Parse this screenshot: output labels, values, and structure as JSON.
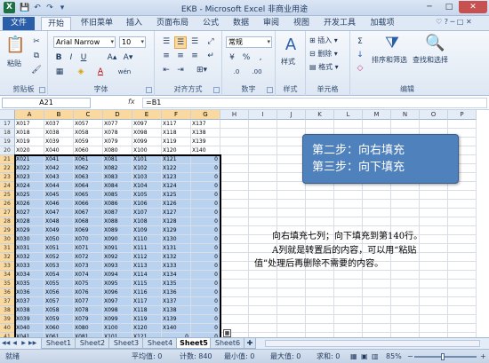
{
  "window": {
    "title": "EKB - Microsoft Excel 非商业用途",
    "app_icon": "X",
    "minimize": "─",
    "maximize": "□",
    "close": "✕"
  },
  "qat": [
    "💾",
    "↶",
    "↷",
    "▾"
  ],
  "tabs": [
    "文件",
    "开始",
    "插入",
    "页面布局",
    "公式",
    "数据",
    "审阅",
    "视图",
    "开发工具",
    "加载项"
  ],
  "tabs_extra": [
    "怀旧菜单"
  ],
  "ribbon_right": "♡ ? ─ □ ✕",
  "ribbon": {
    "clipboard": {
      "label": "剪贴板",
      "paste": "粘贴",
      "cut": "✂",
      "copy": "⧉",
      "painter": "🖌"
    },
    "font": {
      "label": "字体",
      "name": "Arial Narrow",
      "size": "10",
      "bold": "B",
      "italic": "I",
      "underline": "U",
      "grow": "A▴",
      "shrink": "A▾",
      "border": "▦",
      "fill": "◈",
      "color": "A",
      "wen": "wén"
    },
    "align": {
      "label": "对齐方式"
    },
    "number": {
      "label": "数字",
      "format": "常规",
      "percent": "%",
      "comma": ",",
      "currency": "¥",
      "inc": ".0",
      "dec": ".00"
    },
    "styles": {
      "label": "样式",
      "btn": "样式"
    },
    "cells": {
      "label": "单元格",
      "insert": "插入",
      "delete": "删除",
      "format": "格式"
    },
    "editing": {
      "label": "编辑",
      "sigma": "Σ",
      "fill": "↓",
      "clear": "◇",
      "sort": "排序和筛选",
      "find": "查找和选择"
    }
  },
  "formula_bar": {
    "name_box": "A21",
    "fx": "fx",
    "formula": "=B1"
  },
  "columns": [
    "A",
    "B",
    "C",
    "D",
    "E",
    "F",
    "G",
    "H",
    "I",
    "J",
    "K",
    "L",
    "M",
    "N",
    "O",
    "P"
  ],
  "selected_columns": [
    "A",
    "B",
    "C",
    "D",
    "E",
    "F",
    "G"
  ],
  "rows": [
    {
      "n": "17",
      "cells": [
        "X017",
        "X037",
        "X057",
        "X077",
        "X097",
        "X117",
        "X137"
      ]
    },
    {
      "n": "18",
      "cells": [
        "X018",
        "X038",
        "X058",
        "X078",
        "X098",
        "X118",
        "X138"
      ]
    },
    {
      "n": "19",
      "cells": [
        "X019",
        "X039",
        "X059",
        "X079",
        "X099",
        "X119",
        "X139"
      ]
    },
    {
      "n": "20",
      "cells": [
        "X020",
        "X040",
        "X060",
        "X080",
        "X100",
        "X120",
        "X140"
      ]
    },
    {
      "n": "21",
      "cells": [
        "X021",
        "X041",
        "X061",
        "X081",
        "X101",
        "X121",
        "0"
      ]
    },
    {
      "n": "22",
      "cells": [
        "X022",
        "X042",
        "X062",
        "X082",
        "X102",
        "X122",
        "0"
      ]
    },
    {
      "n": "23",
      "cells": [
        "X023",
        "X043",
        "X063",
        "X083",
        "X103",
        "X123",
        "0"
      ]
    },
    {
      "n": "24",
      "cells": [
        "X024",
        "X044",
        "X064",
        "X084",
        "X104",
        "X124",
        "0"
      ]
    },
    {
      "n": "25",
      "cells": [
        "X025",
        "X045",
        "X065",
        "X085",
        "X105",
        "X125",
        "0"
      ]
    },
    {
      "n": "26",
      "cells": [
        "X026",
        "X046",
        "X066",
        "X086",
        "X106",
        "X126",
        "0"
      ]
    },
    {
      "n": "27",
      "cells": [
        "X027",
        "X047",
        "X067",
        "X087",
        "X107",
        "X127",
        "0"
      ]
    },
    {
      "n": "28",
      "cells": [
        "X028",
        "X048",
        "X068",
        "X088",
        "X108",
        "X128",
        "0"
      ]
    },
    {
      "n": "29",
      "cells": [
        "X029",
        "X049",
        "X069",
        "X089",
        "X109",
        "X129",
        "0"
      ]
    },
    {
      "n": "30",
      "cells": [
        "X030",
        "X050",
        "X070",
        "X090",
        "X110",
        "X130",
        "0"
      ]
    },
    {
      "n": "31",
      "cells": [
        "X031",
        "X051",
        "X071",
        "X091",
        "X111",
        "X131",
        "0"
      ]
    },
    {
      "n": "32",
      "cells": [
        "X032",
        "X052",
        "X072",
        "X092",
        "X112",
        "X132",
        "0"
      ]
    },
    {
      "n": "33",
      "cells": [
        "X033",
        "X053",
        "X073",
        "X093",
        "X113",
        "X133",
        "0"
      ]
    },
    {
      "n": "34",
      "cells": [
        "X034",
        "X054",
        "X074",
        "X094",
        "X114",
        "X134",
        "0"
      ]
    },
    {
      "n": "35",
      "cells": [
        "X035",
        "X055",
        "X075",
        "X095",
        "X115",
        "X135",
        "0"
      ]
    },
    {
      "n": "36",
      "cells": [
        "X036",
        "X056",
        "X076",
        "X096",
        "X116",
        "X136",
        "0"
      ]
    },
    {
      "n": "37",
      "cells": [
        "X037",
        "X057",
        "X077",
        "X097",
        "X117",
        "X137",
        "0"
      ]
    },
    {
      "n": "38",
      "cells": [
        "X038",
        "X058",
        "X078",
        "X098",
        "X118",
        "X138",
        "0"
      ]
    },
    {
      "n": "39",
      "cells": [
        "X039",
        "X059",
        "X079",
        "X099",
        "X119",
        "X139",
        "0"
      ]
    },
    {
      "n": "40",
      "cells": [
        "X040",
        "X060",
        "X080",
        "X100",
        "X120",
        "X140",
        "0"
      ]
    },
    {
      "n": "41",
      "cells": [
        "X041",
        "X061",
        "X081",
        "X101",
        "X121",
        "0",
        "0"
      ]
    }
  ],
  "callout": {
    "line1": "第二步：向右填充",
    "line2": "第三步：向下填充"
  },
  "note": {
    "p1": "向右填充七列；向下填充到第140行。",
    "p2": "A列就是转置后的内容，可以用“粘贴值”处理后再删除不需要的内容。"
  },
  "sheets": [
    "Sheet1",
    "Sheet2",
    "Sheet3",
    "Sheet4",
    "Sheet5",
    "Sheet6"
  ],
  "active_sheet": "Sheet5",
  "sheet_nav": [
    "◀◀",
    "◀",
    "▶",
    "▶▶"
  ],
  "status": {
    "mode": "就绪",
    "avg": "平均值: 0",
    "count": "计数: 840",
    "min": "最小值: 0",
    "max": "最大值: 0",
    "sum": "求和: 0",
    "zoom": "85%",
    "zoom_level": 0.85,
    "minus": "−",
    "plus": "+"
  },
  "colors": {
    "accent": "#2a5ea8",
    "selection": "#b8d2ef",
    "callout": "#4f81bd"
  }
}
